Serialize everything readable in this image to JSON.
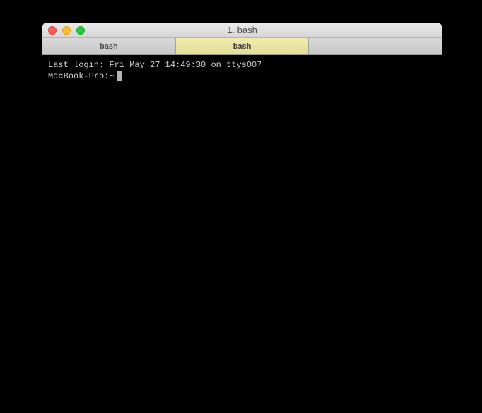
{
  "window": {
    "title": "1. bash"
  },
  "tabs": [
    {
      "label": "bash",
      "active": false
    },
    {
      "label": "bash",
      "active": true
    },
    {
      "label": "",
      "active": false
    }
  ],
  "terminal": {
    "last_login": "Last login: Fri May 27 14:49:30 on ttys007",
    "prompt": "MacBook-Pro:~"
  }
}
